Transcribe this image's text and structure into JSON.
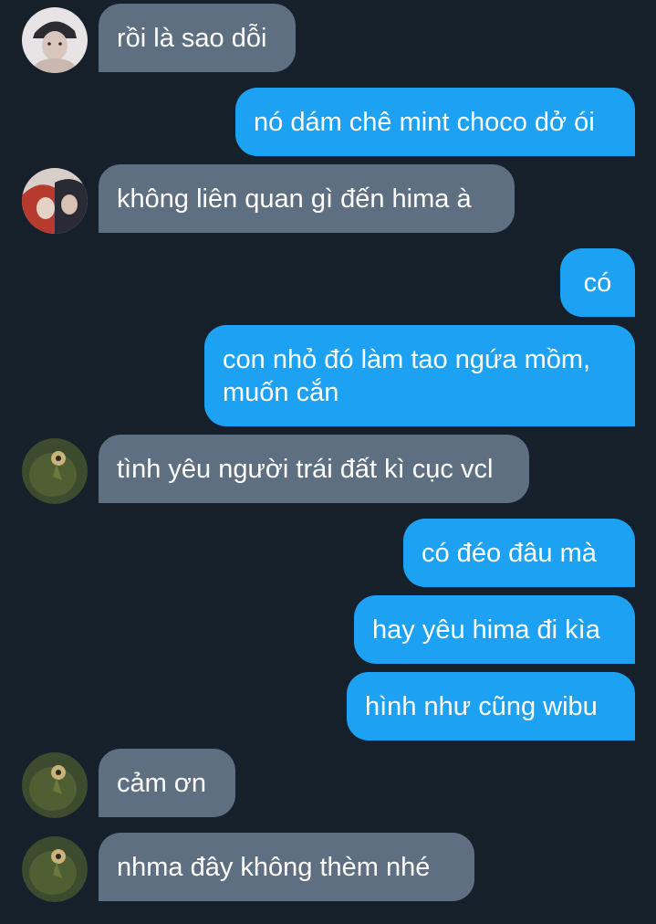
{
  "messages": [
    {
      "side": "in",
      "text": "rồi là sao dỗi"
    },
    {
      "side": "out",
      "text": "nó dám chê mint choco dở ói"
    },
    {
      "side": "in",
      "text": "không liên quan gì đến hima à"
    },
    {
      "side": "out",
      "text": "có"
    },
    {
      "side": "out",
      "text": "con nhỏ đó làm tao ngứa mồm,\nmuốn cắn"
    },
    {
      "side": "in",
      "text": "tình yêu người trái đất kì cục vcl"
    },
    {
      "side": "out",
      "text": "có đéo đâu mà"
    },
    {
      "side": "out",
      "text": "hay yêu hima đi kìa"
    },
    {
      "side": "out",
      "text": "hình như cũng wibu"
    },
    {
      "side": "in",
      "text": "cảm ơn"
    },
    {
      "side": "in",
      "text": "nhma đây không thèm nhé"
    }
  ],
  "avatars": [
    {
      "icon": "user-avatar-girl-cap",
      "colors": [
        "#e8e4e6",
        "#2c2c30",
        "#c9b7b0"
      ]
    },
    {
      "icon": "user-avatar-anime-group",
      "colors": [
        "#d8cfc8",
        "#b73a2f",
        "#2a2a35"
      ]
    },
    {
      "icon": "user-avatar-green-creature",
      "colors": [
        "#3c4a2e",
        "#6b7a3a",
        "#c9b37a"
      ]
    },
    {
      "icon": "user-avatar-green-creature",
      "colors": [
        "#3c4a2e",
        "#6b7a3a",
        "#c9b37a"
      ]
    },
    {
      "icon": "user-avatar-green-creature",
      "colors": [
        "#3c4a2e",
        "#6b7a3a",
        "#c9b37a"
      ]
    }
  ],
  "theme": {
    "background": "#15202b",
    "incoming_bubble": "#5d6f81",
    "outgoing_bubble": "#1da1f2",
    "text": "#ffffff"
  }
}
